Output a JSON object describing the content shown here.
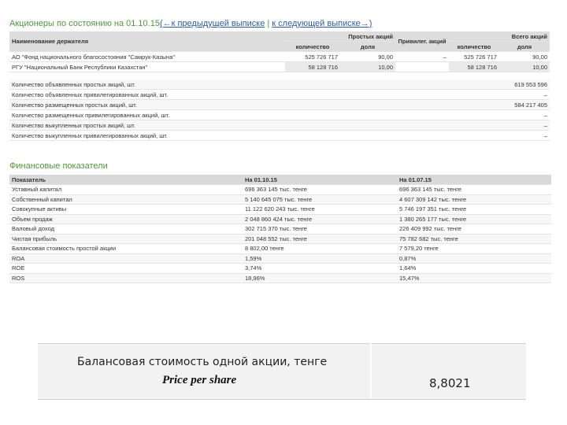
{
  "shareholders_section": {
    "title_prefix": "Акционеры по состоянию на 01.10.15",
    "nav_prev": "(←к предыдущей выписке",
    "separator": " | ",
    "nav_next": "к следующей выписке→)",
    "headers": {
      "holder_name": "Наименование держателя",
      "common_shares": "Простых акций",
      "preferred_shares": "Привилег. акций",
      "total_shares": "Всего акций",
      "quantity": "количество",
      "share": "доля"
    },
    "rows": [
      {
        "name": "АО \"Фонд национального благосостояния \"Самрук-Казына\"",
        "common_qty": "525 726 717",
        "common_share": "90,00",
        "preferred": "–",
        "total_qty": "525 726 717",
        "total_share": "90,00"
      },
      {
        "name": "РГУ \"Национальный Банк Республики Казахстан\"",
        "common_qty": "58 128 716",
        "common_share": "10,00",
        "preferred": "",
        "total_qty": "58 128 716",
        "total_share": "10,00"
      }
    ]
  },
  "share_counts": [
    {
      "label": "Количество объявленных простых акций, шт.",
      "value": "619 553 596"
    },
    {
      "label": "Количество объявленных привилегированных акций, шт.",
      "value": "–"
    },
    {
      "label": "Количество размещенных простых акций, шт.",
      "value": "584 217 405"
    },
    {
      "label": "Количество размещенных привилегированных акций, шт.",
      "value": "–"
    },
    {
      "label": "Количество выкупленных простых акций, шт.",
      "value": "–"
    },
    {
      "label": "Количество выкупленных привилегированных акций, шт.",
      "value": "–"
    }
  ],
  "financials": {
    "title": "Финансовые показатели",
    "headers": {
      "indicator": "Показатель",
      "col1": "На 01.10.15",
      "col2": "На 01.07.15"
    },
    "rows": [
      {
        "name": "Уставный капитал",
        "v1": "696 363 145 тыс. тенге",
        "v2": "696 363 145 тыс. тенге"
      },
      {
        "name": "Собственный капитал",
        "v1": "5 140 645 075 тыс. тенге",
        "v2": "4 607 309 142 тыс. тенге"
      },
      {
        "name": "Совокупные активы",
        "v1": "11 122 620 243 тыс. тенге",
        "v2": "5 746 197 351 тыс. тенге"
      },
      {
        "name": "Объем продаж",
        "v1": "2 048 860 424 тыс. тенге",
        "v2": "1 380 265 177 тыс. тенге"
      },
      {
        "name": "Валовый доход",
        "v1": "302 715 370 тыс. тенге",
        "v2": "226 409 992 тыс. тенге"
      },
      {
        "name": "Чистая прибыль",
        "v1": "201 048 552 тыс. тенге",
        "v2": "75 782 682 тыс. тенге"
      },
      {
        "name": "Балансовая стоимость простой акции",
        "v1": "8 802,00 тенге",
        "v2": "7 579,20 тенге"
      },
      {
        "name": "ROA",
        "v1": "1,59%",
        "v2": "0,87%"
      },
      {
        "name": "ROE",
        "v1": "3,74%",
        "v2": "1,64%"
      },
      {
        "name": "ROS",
        "v1": "18,96%",
        "v2": "15,47%"
      }
    ]
  },
  "caption": {
    "label_ru": "Балансовая стоимость одной акции, тенге",
    "label_en": "Price per share",
    "value": "8,8021"
  }
}
